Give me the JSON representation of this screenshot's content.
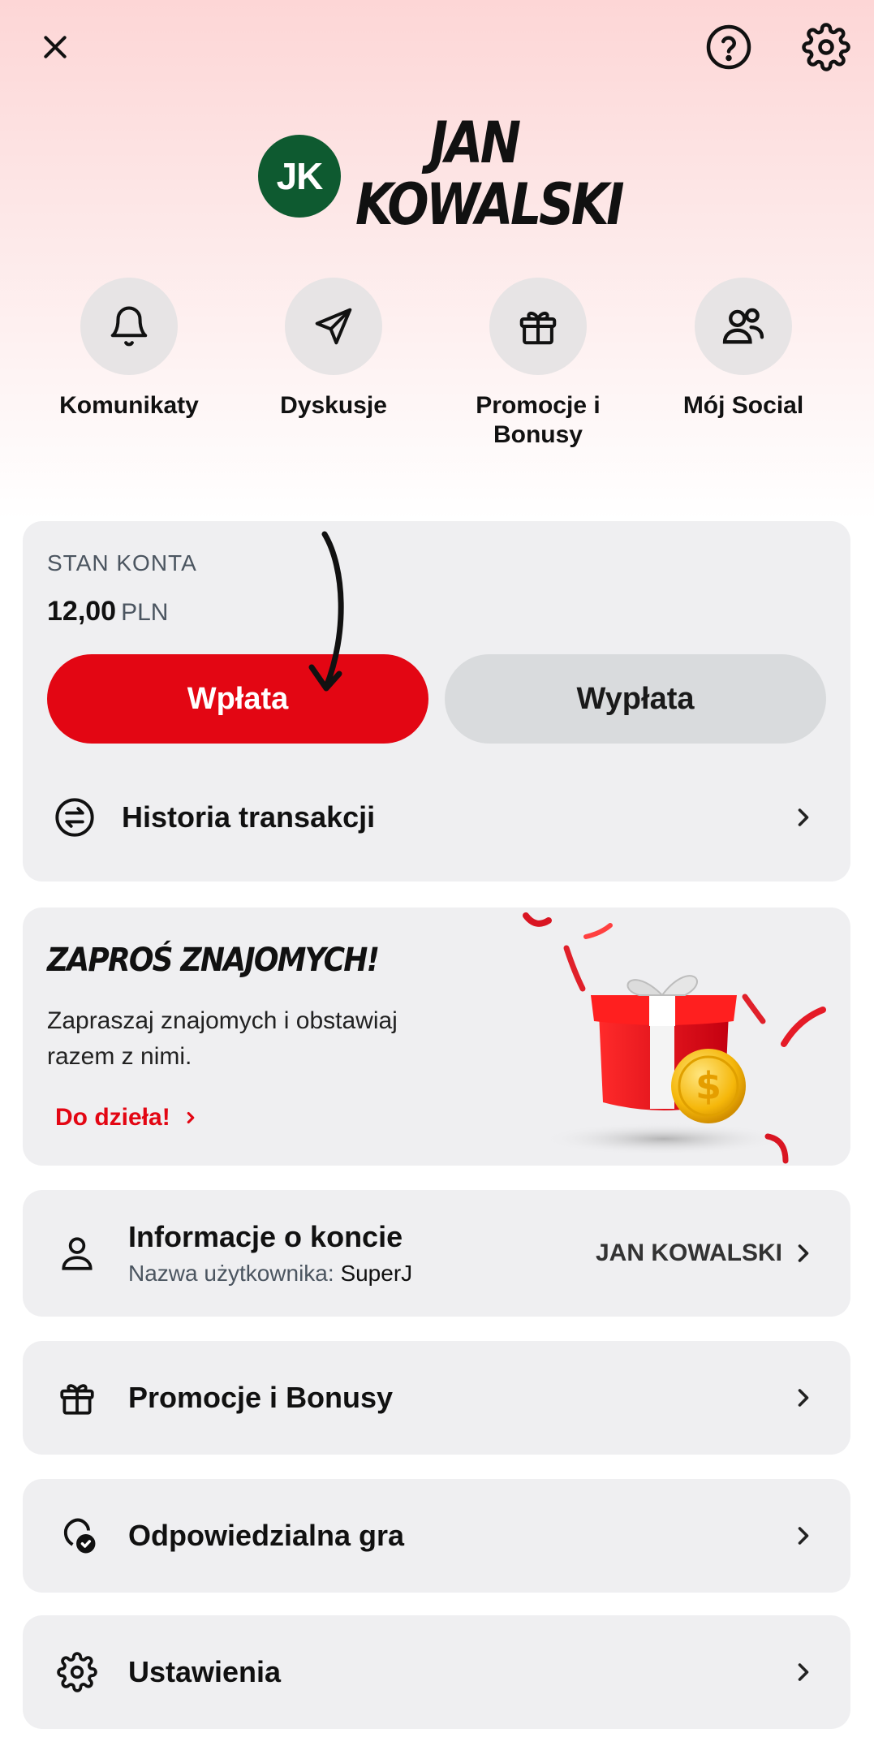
{
  "header": {
    "close_icon": "close-icon",
    "help_icon": "help-icon",
    "settings_icon": "gear-icon"
  },
  "profile": {
    "initials": "JK",
    "first_name": "JAN",
    "last_name": "KOWALSKI",
    "avatar_color": "#0e5a30"
  },
  "quick_actions": [
    {
      "label": "Komunikaty",
      "icon": "bell-icon"
    },
    {
      "label": "Dyskusje",
      "icon": "send-icon"
    },
    {
      "label": "Promocje i Bonusy",
      "icon": "gift-icon"
    },
    {
      "label": "Mój Social",
      "icon": "users-icon"
    }
  ],
  "balance": {
    "title": "STAN KONTA",
    "amount": "12,00",
    "currency": "PLN",
    "deposit_label": "Wpłata",
    "withdraw_label": "Wypłata",
    "history_label": "Historia transakcji"
  },
  "invite": {
    "title": "ZAPROŚ ZNAJOMYCH!",
    "text": "Zapraszaj znajomych i obstawiaj razem z nimi.",
    "link": "Do dzieła!"
  },
  "account_info": {
    "title": "Informacje o koncie",
    "username_label": "Nazwa użytkownika:",
    "username": "SuperJ",
    "name_value": "JAN KOWALSKI"
  },
  "menu": {
    "promotions": "Promocje i Bonusy",
    "responsible": "Odpowiedzialna gra",
    "settings": "Ustawienia"
  },
  "colors": {
    "accent": "#e30613",
    "card_bg": "#efeff1"
  }
}
